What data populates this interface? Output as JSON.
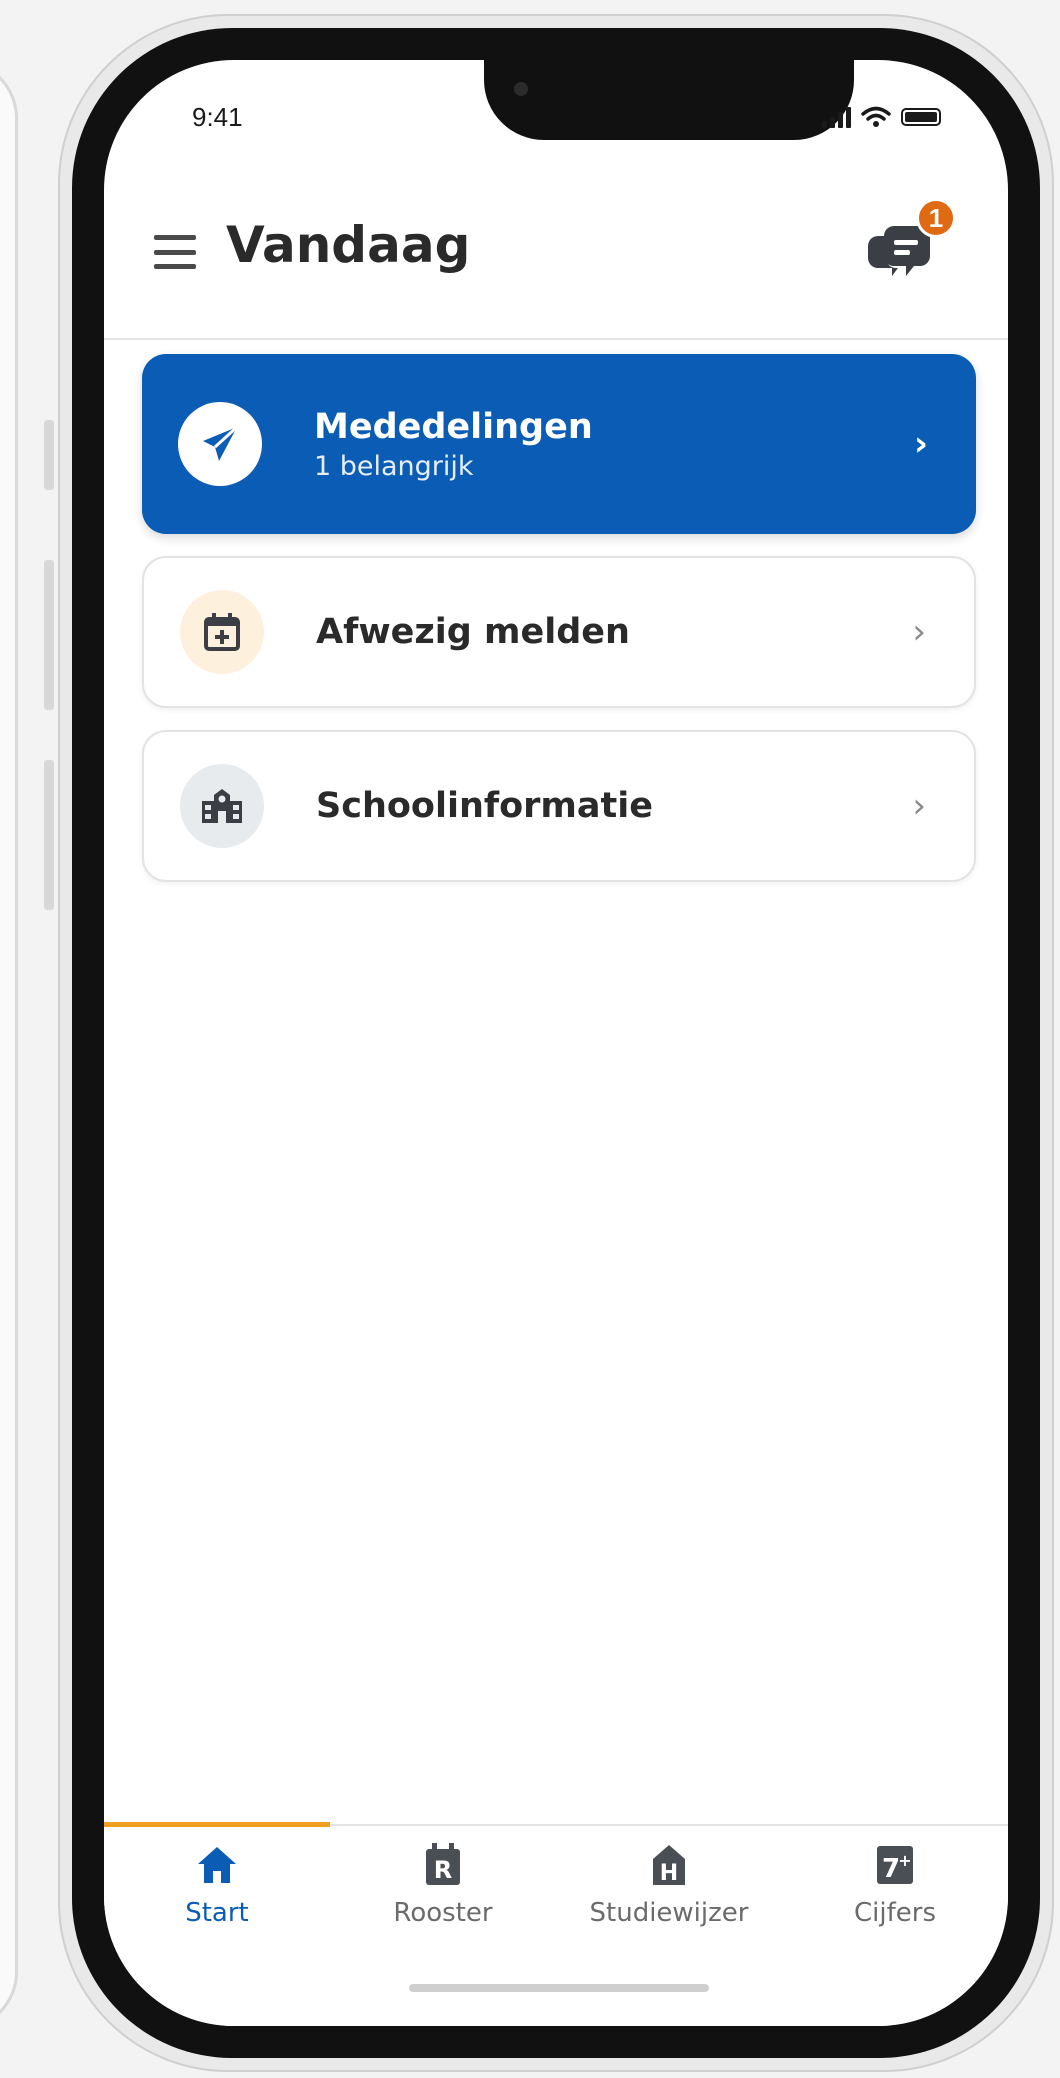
{
  "status_bar": {
    "time": "9:41"
  },
  "header": {
    "title": "Vandaag",
    "menu_icon": "hamburger-menu-icon",
    "messages_icon": "chat-bubble-icon",
    "messages_badge": "1"
  },
  "cards": [
    {
      "title": "Mededelingen",
      "subtitle": "1 belangrijk",
      "icon": "paper-plane-icon",
      "accent": "#0a5cb5"
    },
    {
      "title": "Afwezig melden",
      "icon": "calendar-plus-icon",
      "icon_bg": "#fdf1dd"
    },
    {
      "title": "Schoolinformatie",
      "icon": "school-building-icon",
      "icon_bg": "#e8ebee"
    }
  ],
  "tabs": [
    {
      "label": "Start",
      "icon": "home-icon",
      "active": true
    },
    {
      "label": "Rooster",
      "icon": "rooster-icon",
      "glyph": "R"
    },
    {
      "label": "Studiewijzer",
      "icon": "studiewijzer-icon",
      "glyph": "H"
    },
    {
      "label": "Cijfers",
      "icon": "cijfers-icon",
      "glyph": "7+"
    }
  ],
  "colors": {
    "primary": "#0a5cb5",
    "accent_orange": "#e06a14",
    "tab_indicator": "#f0a020"
  }
}
